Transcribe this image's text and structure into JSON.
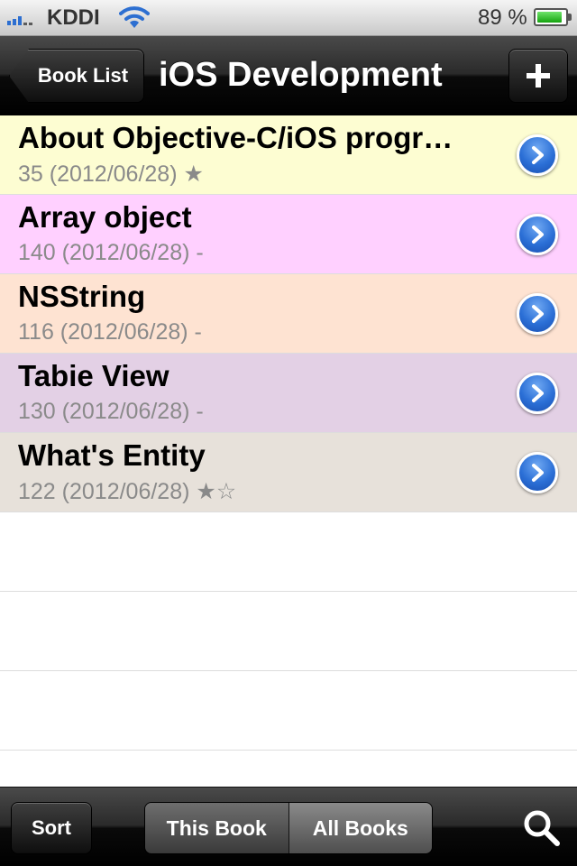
{
  "status_bar": {
    "carrier": "KDDI",
    "battery_percent": "89 %",
    "battery_level": 0.89,
    "signal_bars": 3,
    "icons": [
      "signal-icon",
      "wifi-icon",
      "battery-icon"
    ]
  },
  "nav": {
    "back_label": "Book List",
    "title": "iOS Development",
    "add_icon": "plus-icon"
  },
  "rows": [
    {
      "title": "About Objective-C/iOS progr…",
      "subtitle": "35 (2012/06/28) ★",
      "color": "#fdfdd2"
    },
    {
      "title": "Array object",
      "subtitle": "140 (2012/06/28) -",
      "color": "#ffd0ff"
    },
    {
      "title": "NSString",
      "subtitle": "116 (2012/06/28) -",
      "color": "#fee3d2"
    },
    {
      "title": "Tabie View",
      "subtitle": "130 (2012/06/28) -",
      "color": "#e3d0e5"
    },
    {
      "title": "What's Entity",
      "subtitle": "122 (2012/06/28) ★☆",
      "color": "#e7e1da"
    }
  ],
  "toolbar": {
    "sort_label": "Sort",
    "segments": [
      "This Book",
      "All Books"
    ],
    "selected_segment": "All Books",
    "search_icon": "search-icon"
  },
  "colors": {
    "disclosure_blue": "#2b6fd6",
    "bar_black": "#000000"
  }
}
